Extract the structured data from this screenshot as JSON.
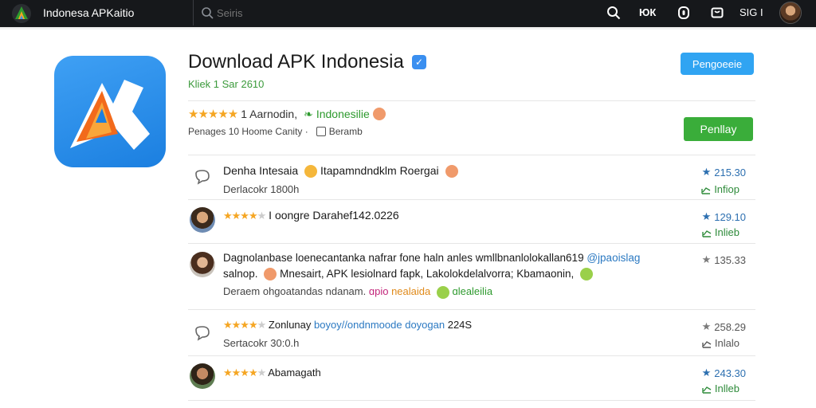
{
  "topbar": {
    "app_name": "Indonesa APKaitio",
    "search_placeholder": "Seiris",
    "icon_label_1": "ЮК",
    "user_label": "SIG I"
  },
  "app": {
    "title": "Download APK Indonesia",
    "subtitle": "Kliek 1 Sar 2610",
    "rating_text": "1 Aarnodin,",
    "category": "Indonesilie",
    "meta_text": "Penages 10 Hoome Canity ·",
    "meta_extra": "Beramb",
    "primary_button": "Pengoeeie",
    "install_button": "Penllay"
  },
  "reviews": [
    {
      "line1_a": "Denha Intesaia",
      "line1_b": "Itapamndndklm Roergai",
      "line2": "Derlacokr 1800h",
      "score": "215.30",
      "trend": "Infiop"
    },
    {
      "line1": "I oongre Darahef142.0226",
      "score": "129.10",
      "trend": "Inlieb"
    },
    {
      "line1_a": "Dagnolanbase loenecantanka nafrar fone haln anles wmllbnanlolokallan619",
      "line1_link": "@jpaoislag",
      "line2_a": "salnop.",
      "line2_b": "Mnesairt, APK lesiolnard fapk, Lakolokdelalvorra; Kbamaonin,",
      "line3_a": "Deraem ohgoatandas ndanam.",
      "line3_pink": "ɑpio",
      "line3_orange": "nealaida",
      "line3_green": "ɑlealeilia",
      "score": "135.33"
    },
    {
      "line1_a": "Zonlunay",
      "line1_link": "boyoy//ondnmoode doyogan",
      "line1_b": "224S",
      "line2": "Sertacokr 30:0.h",
      "score": "258.29",
      "trend": "Inlalo"
    },
    {
      "line1": "Abamagath",
      "score": "243.30",
      "trend": "Inlleb"
    }
  ],
  "colors": {
    "topbar_bg": "#16181b",
    "primary_blue": "#30a4f2",
    "install_green": "#3aad3a",
    "star": "#f5a623"
  }
}
